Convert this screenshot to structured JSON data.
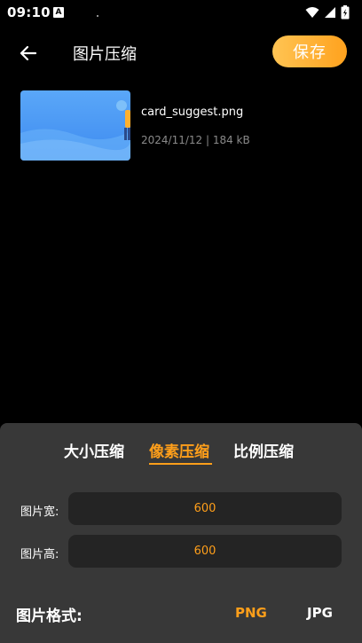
{
  "status_bar": {
    "time": "09:10",
    "notification_letter": "A"
  },
  "header": {
    "title": "图片压缩",
    "save_label": "保存"
  },
  "file": {
    "name": "card_suggest.png",
    "meta": "2024/11/12 | 184 kB"
  },
  "panel": {
    "tabs": [
      {
        "label": "大小压缩",
        "active": false
      },
      {
        "label": "像素压缩",
        "active": true
      },
      {
        "label": "比例压缩",
        "active": false
      }
    ],
    "width_label": "图片宽:",
    "width_value": "600",
    "height_label": "图片高:",
    "height_value": "600",
    "format_label": "图片格式:",
    "formats": [
      {
        "label": "PNG",
        "selected": true
      },
      {
        "label": "JPG",
        "selected": false
      }
    ]
  },
  "colors": {
    "accent": "#FF9F1A",
    "save_gradient_start": "#FFC453",
    "save_gradient_end": "#FFA21E",
    "panel_bg": "#383838",
    "input_bg": "#242424"
  },
  "icons": {
    "back": "arrow-left-icon",
    "wifi": "wifi-icon",
    "signal": "signal-icon",
    "battery": "battery-icon"
  }
}
